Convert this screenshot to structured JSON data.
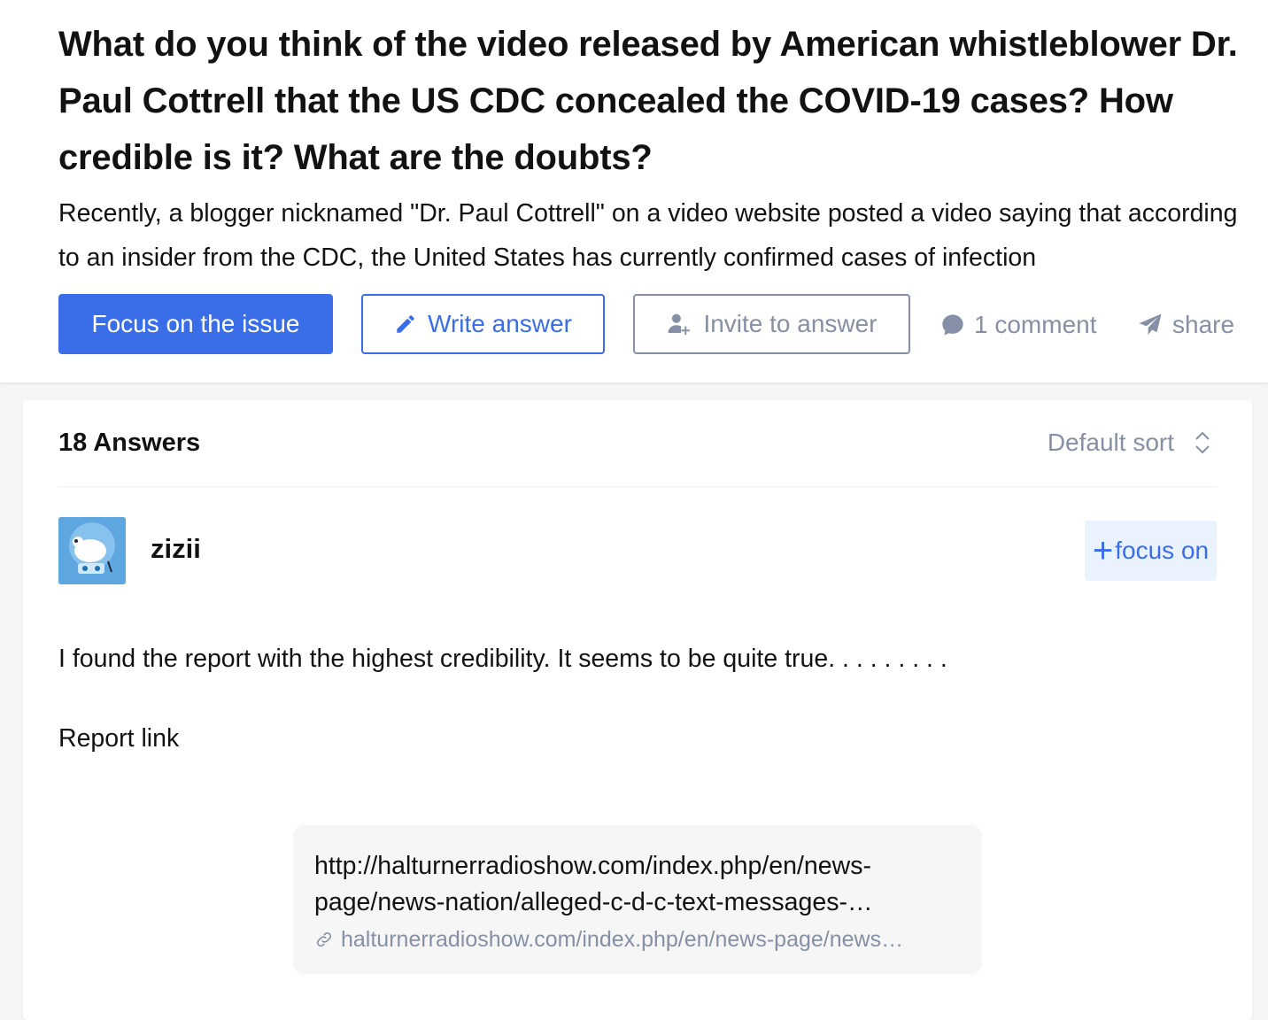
{
  "question": {
    "title": "What do you think of the video released by American whistleblower Dr. Paul Cottrell that the US CDC concealed the COVID-19 cases? How credible is it? What are the doubts?",
    "detail": "Recently, a blogger nicknamed \"Dr. Paul Cottrell\" on a video website posted a video saying that according to an insider from the CDC, the United States has currently confirmed cases of infection"
  },
  "actions": {
    "focus_label": "Focus on the issue",
    "write_label": "Write answer",
    "invite_label": "Invite to answer",
    "comment_label": "1 comment",
    "share_label": "share"
  },
  "answers": {
    "count_label": "18 Answers",
    "sort_label": "Default sort"
  },
  "answer": {
    "author_name": "zizii",
    "follow_label": "focus on",
    "paragraph1": "I found the report with the highest credibility. It seems to be quite true. . . . . . . . .",
    "paragraph2": "Report link",
    "link_title": "http://halturnerradioshow.com/index.php/en/news-page/news-nation/alleged-c-d-c-text-messages-…",
    "link_url": "halturnerradioshow.com/index.php/en/news-page/news…"
  },
  "colors": {
    "accent": "#3a6ee8",
    "muted": "#8590a6",
    "follow_bg": "#ebf2ff",
    "page_bg": "#f6f6f6"
  },
  "icons": {
    "write": "pencil-icon",
    "invite": "add-user-icon",
    "comment": "comment-bubble-icon",
    "share": "paper-plane-icon",
    "sort": "sort-arrows-icon",
    "link": "link-icon"
  }
}
